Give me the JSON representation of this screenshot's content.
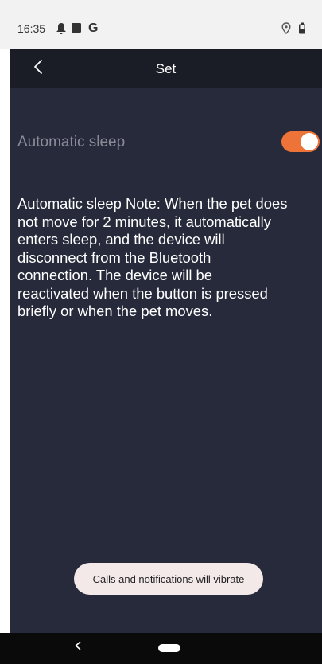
{
  "status_bar": {
    "time": "16:35",
    "left_icons": [
      "bell-icon",
      "square-icon",
      "google-g-icon"
    ],
    "g_letter": "G",
    "right_icons": [
      "location-icon",
      "battery-icon"
    ]
  },
  "header": {
    "title": "Set",
    "back_icon": "chevron-left-icon"
  },
  "settings": {
    "automatic_sleep": {
      "label": "Automatic sleep",
      "enabled": true,
      "accent_color": "#EE7339"
    }
  },
  "note": {
    "text": "Automatic sleep Note: When the pet does\nnot move for 2 minutes, it automatically\nenters sleep, and the  device will\ndisconnect from the Bluetooth\nconnection. The device will be\nreactivated when the button is   pressed\nbriefly or when the pet moves."
  },
  "toast": {
    "text": "Calls and notifications will vibrate"
  },
  "nav_bar": {
    "icons": [
      "back-icon",
      "home-pill-icon"
    ]
  },
  "colors": {
    "app_background": "#272A3A",
    "header_background": "#1A1C26",
    "status_bar_background": "#F2F2F2",
    "nav_bar_background": "#0A0A0A",
    "toast_background": "#F3E9E9"
  }
}
